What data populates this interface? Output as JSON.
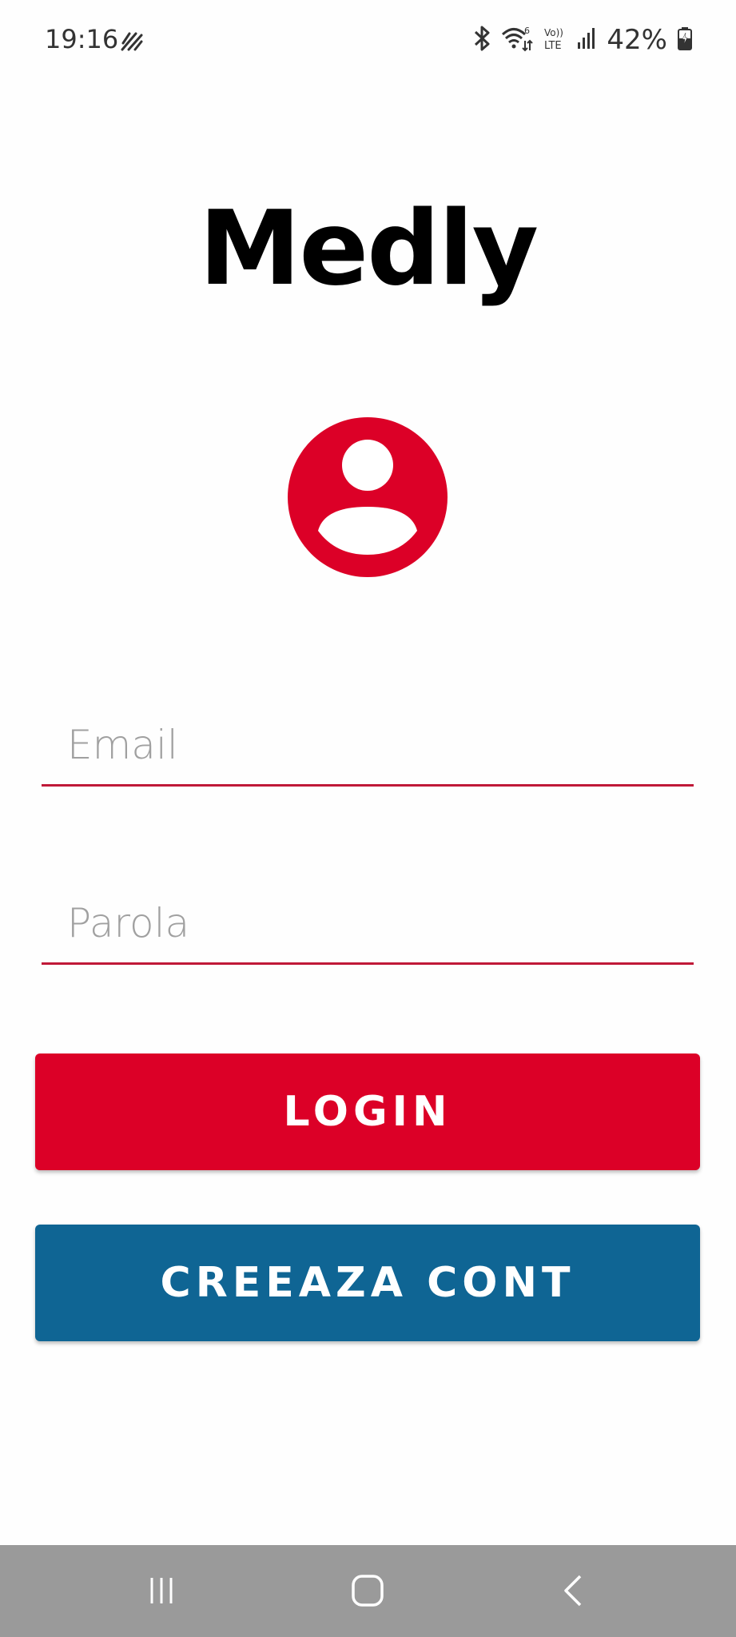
{
  "status_bar": {
    "time": "19:16",
    "battery_percent": "42%",
    "icons": [
      "activity-icon",
      "bluetooth-icon",
      "wifi-6-icon",
      "volte-icon",
      "signal-icon",
      "battery-charging-icon"
    ],
    "volte_line1": "Vo))",
    "volte_line2": "LTE",
    "wifi_generation": "6"
  },
  "app": {
    "title": "Medly"
  },
  "avatar": {
    "icon": "account-circle-icon",
    "color": "#dc0027"
  },
  "form": {
    "email": {
      "placeholder": "Email",
      "value": ""
    },
    "password": {
      "placeholder": "Parola",
      "value": ""
    },
    "underline_color": "#c01938"
  },
  "buttons": {
    "login_label": "LOGIN",
    "create_account_label": "CREEAZA CONT",
    "login_color": "#dc0027",
    "create_color": "#0f6594"
  },
  "nav_bar": {
    "icons": [
      "recent-apps-icon",
      "home-icon",
      "back-icon"
    ]
  }
}
